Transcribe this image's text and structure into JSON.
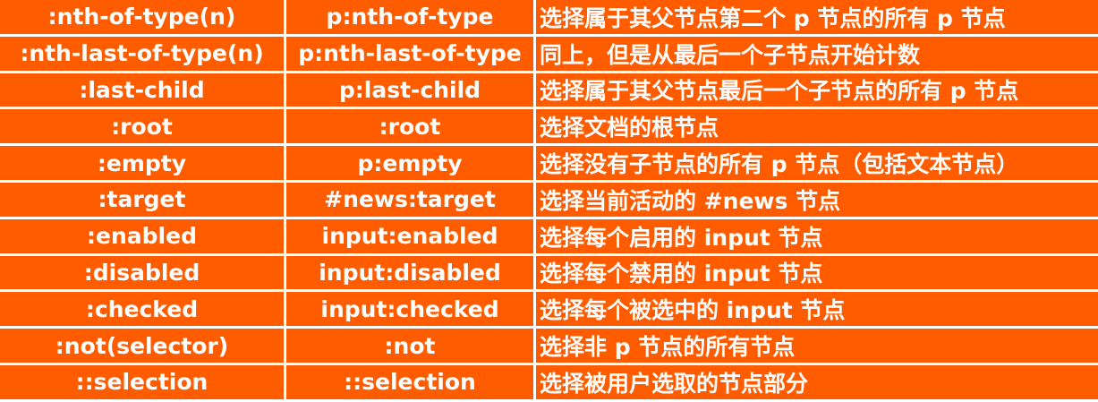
{
  "rows": [
    {
      "selector": ":nth-of-type(n)",
      "example": "p:nth-of-type",
      "description": "选择属于其父节点第二个 p 节点的所有 p 节点"
    },
    {
      "selector": ":nth-last-of-type(n)",
      "example": "p:nth-last-of-type",
      "description": "同上，但是从最后一个子节点开始计数"
    },
    {
      "selector": ":last-child",
      "example": "p:last-child",
      "description": "选择属于其父节点最后一个子节点的所有 p 节点"
    },
    {
      "selector": ":root",
      "example": ":root",
      "description": "选择文档的根节点"
    },
    {
      "selector": ":empty",
      "example": "p:empty",
      "description": "选择没有子节点的所有 p 节点（包括文本节点）"
    },
    {
      "selector": ":target",
      "example": "#news:target",
      "description": "选择当前活动的 #news 节点"
    },
    {
      "selector": ":enabled",
      "example": "input:enabled",
      "description": "选择每个启用的 input 节点"
    },
    {
      "selector": ":disabled",
      "example": "input:disabled",
      "description": "选择每个禁用的 input 节点"
    },
    {
      "selector": ":checked",
      "example": "input:checked",
      "description": "选择每个被选中的 input 节点"
    },
    {
      "selector": ":not(selector)",
      "example": ":not",
      "description": "选择非 p 节点的所有节点"
    },
    {
      "selector": "::selection",
      "example": "::selection",
      "description": "选择被用户选取的节点部分"
    }
  ]
}
